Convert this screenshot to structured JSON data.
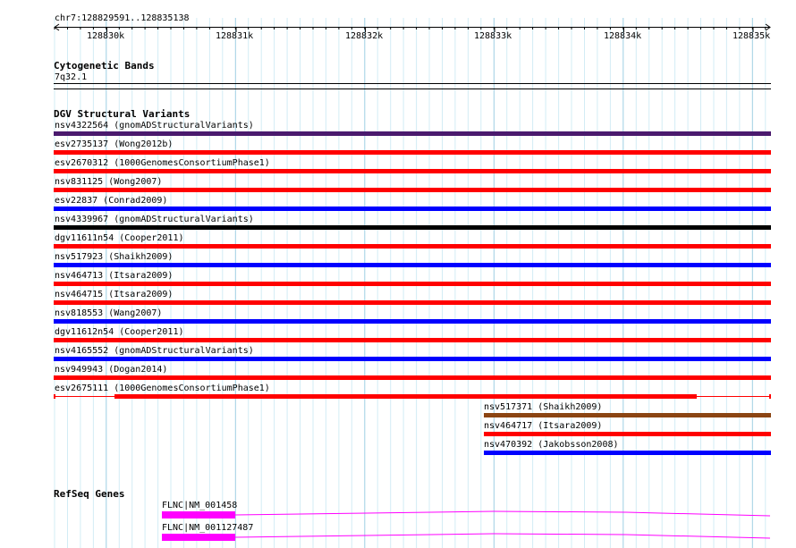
{
  "region": "chr7:128829591..128835138",
  "ruler": {
    "ticks": [
      "128830k",
      "128831k",
      "128832k",
      "128833k",
      "128834k",
      "128835k"
    ]
  },
  "cytoband": {
    "title": "Cytogenetic Bands",
    "band": "7q32.1"
  },
  "dgv": {
    "title": "DGV Structural Variants",
    "features": [
      {
        "label": "nsv4322564 (gnomADStructuralVariants)",
        "color": "#4a1a6e"
      },
      {
        "label": "esv2735137 (Wong2012b)",
        "color": "#ff0000"
      },
      {
        "label": "esv2670312 (1000GenomesConsortiumPhase1)",
        "color": "#ff0000"
      },
      {
        "label": "nsv831125 (Wong2007)",
        "color": "#ff0000"
      },
      {
        "label": "esv22837 (Conrad2009)",
        "color": "#0000ff"
      },
      {
        "label": "nsv4339967 (gnomADStructuralVariants)",
        "color": "#000000"
      },
      {
        "label": "dgv11611n54 (Cooper2011)",
        "color": "#ff0000"
      },
      {
        "label": "nsv517923 (Shaikh2009)",
        "color": "#0000ff"
      },
      {
        "label": "nsv464713 (Itsara2009)",
        "color": "#ff0000"
      },
      {
        "label": "nsv464715 (Itsara2009)",
        "color": "#ff0000"
      },
      {
        "label": "nsv818553 (Wang2007)",
        "color": "#0000ff"
      },
      {
        "label": "dgv11612n54 (Cooper2011)",
        "color": "#ff0000"
      },
      {
        "label": "nsv4165552 (gnomADStructuralVariants)",
        "color": "#0000ff"
      },
      {
        "label": "nsv949943 (Dogan2014)",
        "color": "#ff0000"
      },
      {
        "label": "esv2675111 (1000GenomesConsortiumPhase1)",
        "color": "#ff0000"
      },
      {
        "label": "nsv517371 (Shaikh2009)",
        "color": "#8b4513"
      },
      {
        "label": "nsv464717 (Itsara2009)",
        "color": "#ff0000"
      },
      {
        "label": "nsv470392 (Jakobsson2008)",
        "color": "#0000ff"
      }
    ]
  },
  "refseq": {
    "title": "RefSeq Genes",
    "genes": [
      {
        "label": "FLNC|NM_001458",
        "color": "#ff00ff"
      },
      {
        "label": "FLNC|NM_001127487",
        "color": "#ff00ff"
      }
    ]
  }
}
